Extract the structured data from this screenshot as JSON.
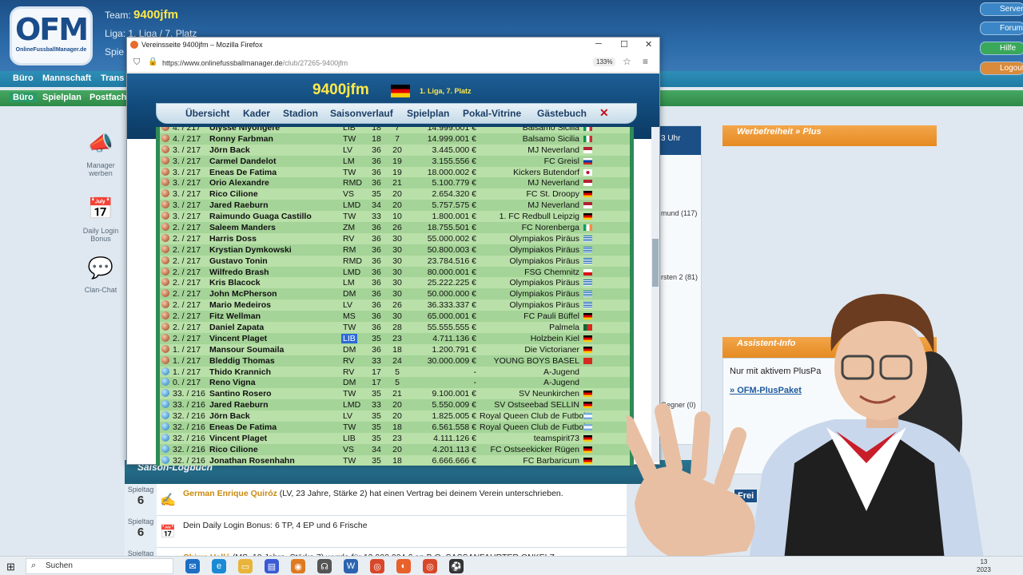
{
  "site": {
    "logo_text": "OFM",
    "logo_caption": "OnlineFussballManager.de",
    "team_label": "Team:",
    "team_name": "9400jfm",
    "league_label": "Liga: 1. Liga   /   7. Platz",
    "spiel_label": "Spie"
  },
  "nav_top": [
    "Büro",
    "Mannschaft",
    "Trans"
  ],
  "nav_sub": [
    "Büro",
    "Spielplan",
    "Postfach"
  ],
  "right_buttons": [
    "Server2",
    "Forum",
    "Hilfe",
    "Logout"
  ],
  "sidebar": [
    {
      "label": "Manager werben",
      "icon": "megaphone-icon"
    },
    {
      "label": "Daily Login Bonus",
      "icon": "calendar-icon"
    },
    {
      "label": "Clan-Chat",
      "icon": "chat-icon"
    }
  ],
  "right_panel": {
    "header": "Werbefreiheit » Plus"
  },
  "mid_col": {
    "top": "3 Uhr",
    "lines": [
      "mund (117)",
      "rsten 2 (81)",
      "Gegner (0)"
    ]
  },
  "assistant": {
    "header": "Assistent-Info",
    "text": "Nur mit aktivem PlusPa",
    "link": "OFM-PlusPaket",
    "partial": "Frei"
  },
  "browser": {
    "title": "Vereinsseite 9400jfm – Mozilla Firefox",
    "url_host": "https://www.onlinefussballmanager.de",
    "url_path": "/club/27265-9400jfm",
    "zoom": "133%"
  },
  "club": {
    "name": "9400jfm",
    "league": "1. Liga, 7. Platz",
    "tabs": [
      "Übersicht",
      "Kader",
      "Stadion",
      "Saisonverlauf",
      "Spielplan",
      "Pokal-Vitrine",
      "Gästebuch"
    ]
  },
  "transfers": [
    {
      "season": "4. / 217",
      "name": "Ulysse Niyongere",
      "pos": "LIB",
      "age": "18",
      "str": "7",
      "fee": "14.999.001 €",
      "club": "Balsamo Sicilia",
      "flag": "it"
    },
    {
      "season": "4. / 217",
      "name": "Ronny Farbman",
      "pos": "TW",
      "age": "18",
      "str": "7",
      "fee": "14.999.001 €",
      "club": "Balsamo Sicilia",
      "flag": "it"
    },
    {
      "season": "3. / 217",
      "name": "Jörn Back",
      "pos": "LV",
      "age": "36",
      "str": "20",
      "fee": "3.445.000 €",
      "club": "MJ Neverland",
      "flag": "us"
    },
    {
      "season": "3. / 217",
      "name": "Carmel Dandelot",
      "pos": "LM",
      "age": "36",
      "str": "19",
      "fee": "3.155.556 €",
      "club": "FC Greisl",
      "flag": "ru"
    },
    {
      "season": "3. / 217",
      "name": "Eneas De Fatima",
      "pos": "TW",
      "age": "36",
      "str": "19",
      "fee": "18.000.002 €",
      "club": "Kickers Butendorf",
      "flag": "kr"
    },
    {
      "season": "3. / 217",
      "name": "Orio Alexandre",
      "pos": "RMD",
      "age": "36",
      "str": "21",
      "fee": "5.100.779 €",
      "club": "MJ Neverland",
      "flag": "us"
    },
    {
      "season": "3. / 217",
      "name": "Rico Cilione",
      "pos": "VS",
      "age": "35",
      "str": "20",
      "fee": "2.654.320 €",
      "club": "FC St. Droopy",
      "flag": "de"
    },
    {
      "season": "3. / 217",
      "name": "Jared Raeburn",
      "pos": "LMD",
      "age": "34",
      "str": "20",
      "fee": "5.757.575 €",
      "club": "MJ Neverland",
      "flag": "us"
    },
    {
      "season": "3. / 217",
      "name": "Raimundo Guaga Castillo",
      "pos": "TW",
      "age": "33",
      "str": "10",
      "fee": "1.800.001 €",
      "club": "1. FC Redbull Leipzig",
      "flag": "de"
    },
    {
      "season": "2. / 217",
      "name": "Saleem Manders",
      "pos": "ZM",
      "age": "36",
      "str": "26",
      "fee": "18.755.501 €",
      "club": "FC Norenberga",
      "flag": "ie"
    },
    {
      "season": "2. / 217",
      "name": "Harris Doss",
      "pos": "RV",
      "age": "36",
      "str": "30",
      "fee": "55.000.002 €",
      "club": "Olympiakos Piräus",
      "flag": "gr"
    },
    {
      "season": "2. / 217",
      "name": "Krystian Dymkowski",
      "pos": "RM",
      "age": "36",
      "str": "30",
      "fee": "50.800.003 €",
      "club": "Olympiakos Piräus",
      "flag": "gr"
    },
    {
      "season": "2. / 217",
      "name": "Gustavo Tonin",
      "pos": "RMD",
      "age": "36",
      "str": "30",
      "fee": "23.784.516 €",
      "club": "Olympiakos Piräus",
      "flag": "gr"
    },
    {
      "season": "2. / 217",
      "name": "Wilfredo Brash",
      "pos": "LMD",
      "age": "36",
      "str": "30",
      "fee": "80.000.001 €",
      "club": "FSG Chemnitz",
      "flag": "cz"
    },
    {
      "season": "2. / 217",
      "name": "Kris Blacock",
      "pos": "LM",
      "age": "36",
      "str": "30",
      "fee": "25.222.225 €",
      "club": "Olympiakos Piräus",
      "flag": "gr"
    },
    {
      "season": "2. / 217",
      "name": "John McPherson",
      "pos": "DM",
      "age": "36",
      "str": "30",
      "fee": "50.000.000 €",
      "club": "Olympiakos Piräus",
      "flag": "gr"
    },
    {
      "season": "2. / 217",
      "name": "Mario Medeiros",
      "pos": "LV",
      "age": "36",
      "str": "26",
      "fee": "36.333.337 €",
      "club": "Olympiakos Piräus",
      "flag": "gr"
    },
    {
      "season": "2. / 217",
      "name": "Fitz Wellman",
      "pos": "MS",
      "age": "36",
      "str": "30",
      "fee": "65.000.001 €",
      "club": "FC Pauli Büffel",
      "flag": "de"
    },
    {
      "season": "2. / 217",
      "name": "Daniel Zapata",
      "pos": "TW",
      "age": "36",
      "str": "28",
      "fee": "55.555.555 €",
      "club": "Palmela",
      "flag": "pt"
    },
    {
      "season": "2. / 217",
      "name": "Vincent Plaget",
      "pos": "LIB",
      "age": "35",
      "str": "23",
      "fee": "4.711.136 €",
      "club": "Holzbein Kiel",
      "flag": "de",
      "hl": true
    },
    {
      "season": "1. / 217",
      "name": "Mansour Soumaila",
      "pos": "DM",
      "age": "36",
      "str": "18",
      "fee": "1.200.791 €",
      "club": "Die Victorianer",
      "flag": "de"
    },
    {
      "season": "1. / 217",
      "name": "Bleddig Thomas",
      "pos": "RV",
      "age": "33",
      "str": "24",
      "fee": "30.000.009 €",
      "club": "YOUNG BOYS BASEL",
      "flag": "ch"
    },
    {
      "season": "1. / 217",
      "name": "Thido Krannich",
      "pos": "RV",
      "age": "17",
      "str": "5",
      "fee": "-",
      "club": "A-Jugend",
      "flag": "",
      "blue": true
    },
    {
      "season": "0. / 217",
      "name": "Reno Vigna",
      "pos": "DM",
      "age": "17",
      "str": "5",
      "fee": "-",
      "club": "A-Jugend",
      "flag": "",
      "blue": true
    },
    {
      "season": "33. / 216",
      "name": "Santino Rosero",
      "pos": "TW",
      "age": "35",
      "str": "21",
      "fee": "9.100.001 €",
      "club": "SV Neunkirchen",
      "flag": "de",
      "blue": true
    },
    {
      "season": "33. / 216",
      "name": "Jared Raeburn",
      "pos": "LMD",
      "age": "33",
      "str": "20",
      "fee": "5.550.009 €",
      "club": "SV Ostseebad SELLIN",
      "flag": "de",
      "blue": true
    },
    {
      "season": "32. / 216",
      "name": "Jörn Back",
      "pos": "LV",
      "age": "35",
      "str": "20",
      "fee": "1.825.005 €",
      "club": "Royal Queen Club de Futbol",
      "flag": "ar",
      "blue": true
    },
    {
      "season": "32. / 216",
      "name": "Eneas De Fatima",
      "pos": "TW",
      "age": "35",
      "str": "18",
      "fee": "6.561.558 €",
      "club": "Royal Queen Club de Futbol",
      "flag": "ar",
      "blue": true
    },
    {
      "season": "32. / 216",
      "name": "Vincent Plaget",
      "pos": "LIB",
      "age": "35",
      "str": "23",
      "fee": "4.111.126 €",
      "club": "teamspirit73",
      "flag": "de",
      "blue": true
    },
    {
      "season": "32. / 216",
      "name": "Rico Cilione",
      "pos": "VS",
      "age": "34",
      "str": "20",
      "fee": "4.201.113 €",
      "club": "FC Ostseekicker Rügen",
      "flag": "de",
      "blue": true
    },
    {
      "season": "32. / 216",
      "name": "Jonathan Rosenhahn",
      "pos": "TW",
      "age": "35",
      "str": "18",
      "fee": "6.666.666 €",
      "club": "FC Barbaricum",
      "flag": "de",
      "blue": true
    }
  ],
  "logbook": {
    "title": "Saison-Logbuch",
    "entries": [
      {
        "day_label": "Spieltag",
        "day": "6",
        "player": "German Enrique Quiróz",
        "text": " (LV, 23 Jahre, Stärke 2) hat einen Vertrag bei deinem Verein unterschrieben."
      },
      {
        "day_label": "Spieltag",
        "day": "6",
        "player": "",
        "text": "Dein Daily Login Bonus: 6 TP, 4 EP und 6 Frische"
      },
      {
        "day_label": "Spieltag",
        "day": "",
        "player": "Chiwa Hallé",
        "text": " (MS, 18 Jahre, Stärke 7) wurde für 12.000.004 € an B.O. SASSANFAHRTER ONKELZ"
      }
    ]
  },
  "taskbar": {
    "search": "Suchen",
    "date": "13",
    "year": "2023"
  }
}
